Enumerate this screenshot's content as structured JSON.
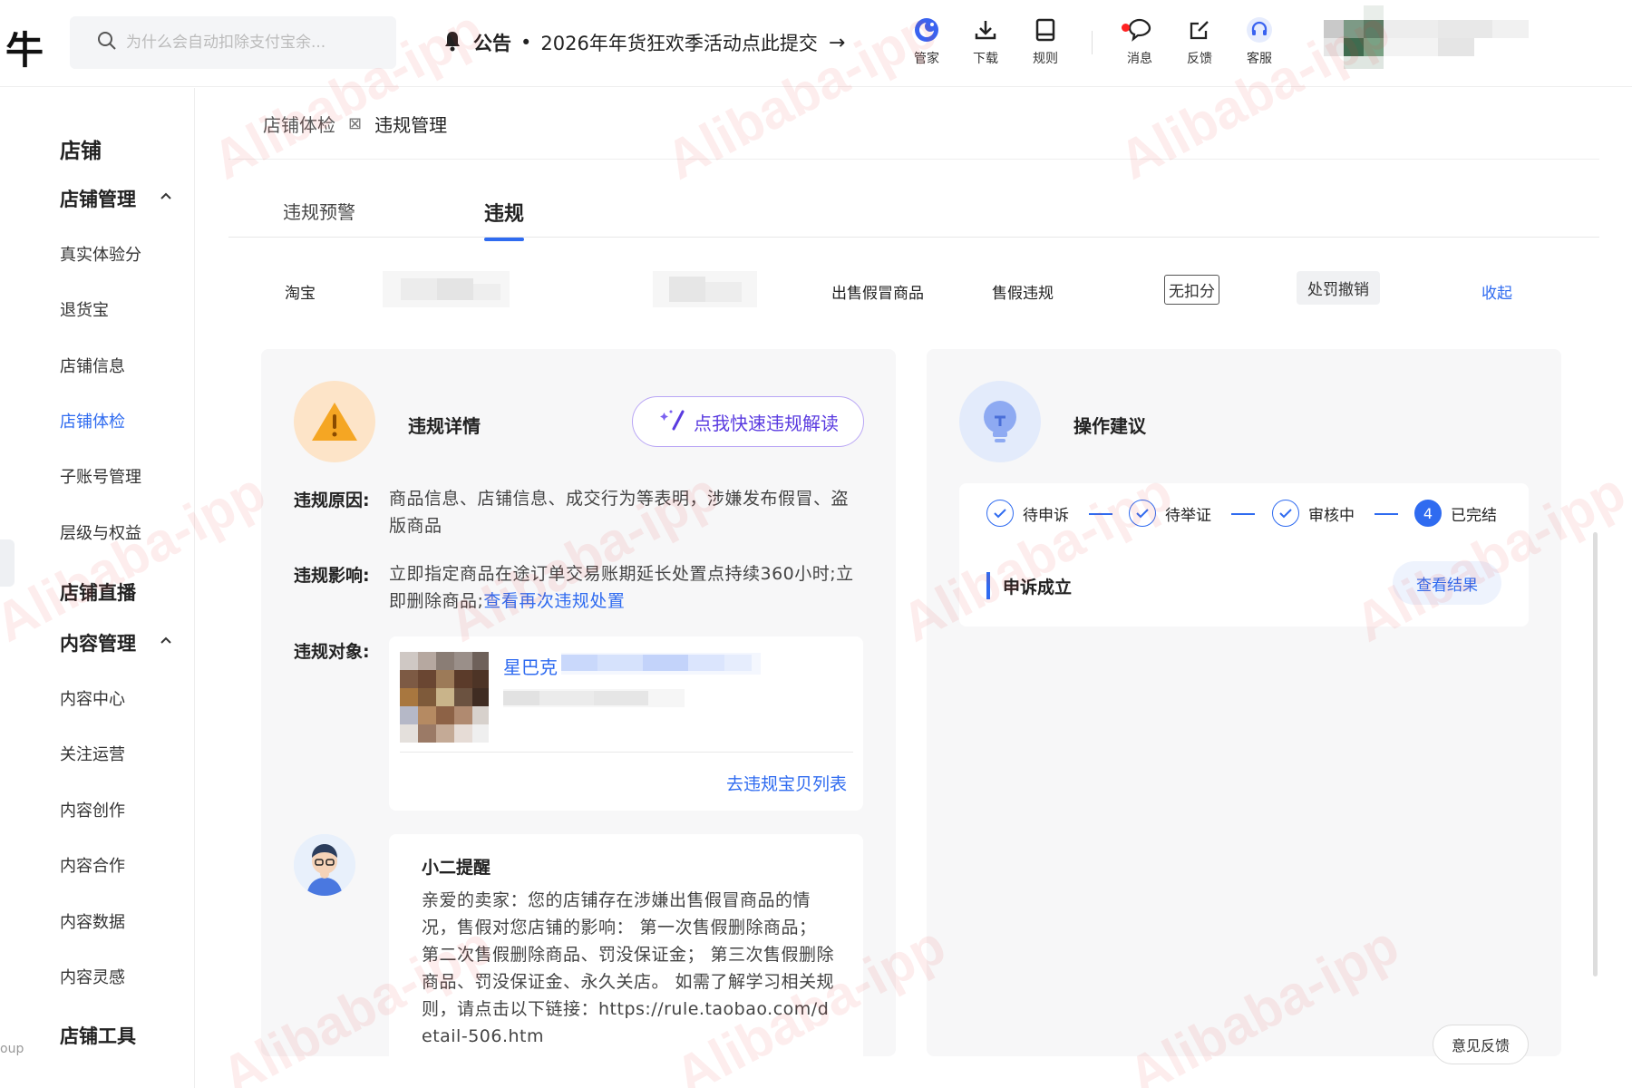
{
  "header": {
    "logo_char": "牛",
    "search_placeholder": "为什么会自动扣除支付宝余...",
    "announcement": {
      "label": "公告",
      "separator": "•",
      "text": "2026年年货狂欢季活动点此提交",
      "arrow": "→"
    },
    "tools": [
      {
        "label": "管家",
        "icon": "assistant-icon"
      },
      {
        "label": "下载",
        "icon": "download-icon"
      },
      {
        "label": "规则",
        "icon": "book-icon"
      },
      {
        "label": "消息",
        "icon": "message-icon"
      },
      {
        "label": "反馈",
        "icon": "feedback-icon"
      },
      {
        "label": "客服",
        "icon": "headset-icon"
      }
    ]
  },
  "sidebar": {
    "section_title": "店铺",
    "groups": [
      {
        "label": "店铺管理",
        "items": [
          "真实体验分",
          "退货宝",
          "店铺信息",
          "店铺体检",
          "子账号管理",
          "层级与权益"
        ]
      },
      {
        "label": "店铺直播",
        "items": []
      },
      {
        "label": "内容管理",
        "items": [
          "内容中心",
          "关注运营",
          "内容创作",
          "内容合作",
          "内容数据",
          "内容灵感"
        ]
      },
      {
        "label": "店铺工具",
        "items": []
      }
    ],
    "active_item": "店铺体检",
    "bottom_hint": "oup"
  },
  "breadcrumb": {
    "parent": "店铺体检",
    "separator": "⊠",
    "current": "违规管理"
  },
  "tabs": [
    {
      "label": "违规预警",
      "active": false
    },
    {
      "label": "违规",
      "active": true
    }
  ],
  "summary": {
    "platform": "淘宝",
    "violation_type": "出售假冒商品",
    "category": "售假违规",
    "deduction": "无扣分",
    "status": "处罚撤销",
    "collapse_label": "收起"
  },
  "details": {
    "title": "违规详情",
    "ai_button": "点我快速违规解读",
    "reason_label": "违规原因:",
    "reason_text": "商品信息、店铺信息、成交行为等表明，涉嫌发布假冒、盗版商品",
    "impact_label": "违规影响:",
    "impact_text": "立即指定商品在途订单交易账期延长处置点持续360小时;立即删除商品;",
    "impact_link": "查看再次违规处置",
    "object_label": "违规对象:",
    "object_name": "星巴克",
    "object_link": "去违规宝贝列表",
    "reminder_title": "小二提醒",
    "reminder_text": "亲爱的卖家：您的店铺存在涉嫌出售假冒商品的情况，售假对您店铺的影响： 第一次售假删除商品； 第二次售假删除商品、罚没保证金； 第三次售假删除商品、罚没保证金、永久关店。 如需了解学习相关规则，请点击以下链接：https://rule.taobao.com/detail-506.htm"
  },
  "advice": {
    "title": "操作建议",
    "steps": [
      {
        "label": "待申诉",
        "state": "done"
      },
      {
        "label": "待举证",
        "state": "done"
      },
      {
        "label": "审核中",
        "state": "done"
      },
      {
        "label": "已完结",
        "state": "current",
        "number": "4"
      }
    ],
    "result_title": "申诉成立",
    "result_button": "查看结果"
  },
  "feedback_button": "意见反馈",
  "watermark": "Alibaba-ipp",
  "colors": {
    "accent": "#2f6bf0",
    "warning": "#f5a623",
    "ai_purple": "#5a3be0"
  }
}
